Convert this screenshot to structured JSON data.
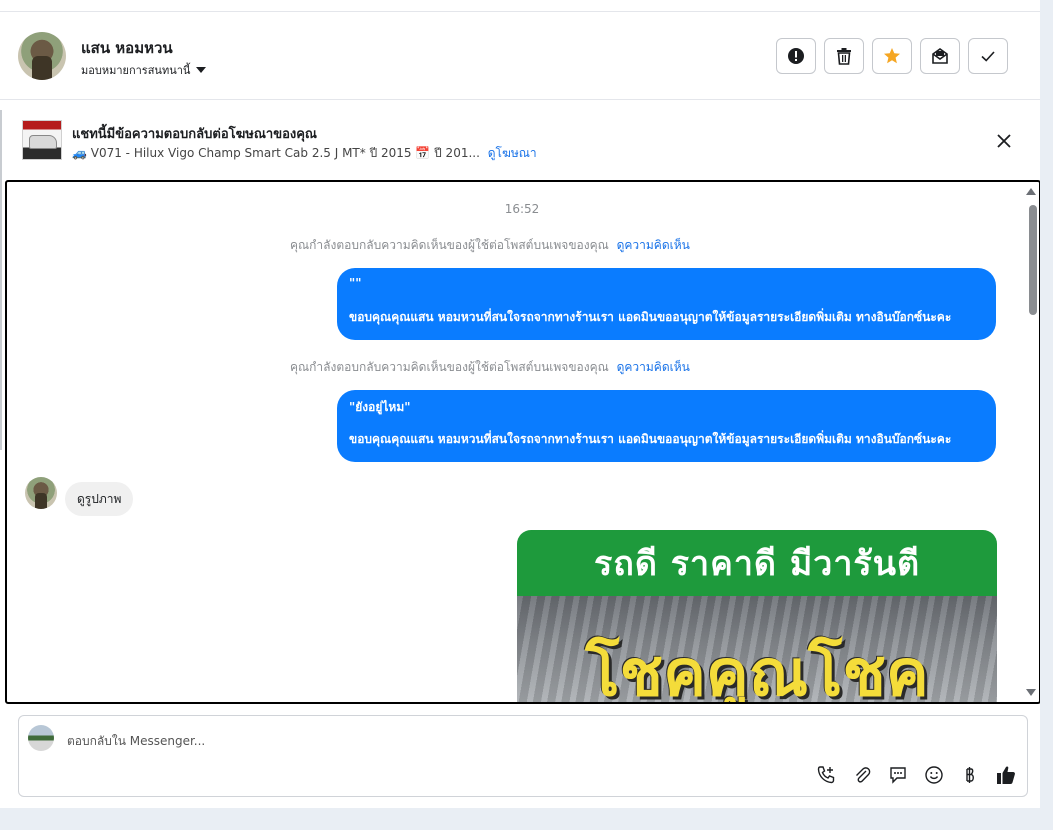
{
  "header": {
    "contact_name": "แสน หอมหวน",
    "assign_label": "มอบหมายการสนทนานี้"
  },
  "ad": {
    "title": "แชทนี้มีข้อความตอบกลับต่อโฆษณาของคุณ",
    "subtitle": "🚙 V071 - Hilux Vigo Champ Smart Cab 2.5 J MT* ปี 2015 📅 ปี 201...",
    "link": "ดูโฆษณา"
  },
  "conversation": {
    "timestamp": "16:52",
    "system_note": "คุณกำลังตอบกลับความคิดเห็นของผู้ใช้ต่อโพสต์บนเพจของคุณ",
    "system_link": "ดูความคิดเห็น",
    "messages_out": [
      {
        "quote": "\"\"",
        "body": "ขอบคุณคุณแสน หอมหวนที่สนใจรถจากทางร้านเรา แอดมินขออนุญาตให้ข้อมูลรายระเอียดพิ่มเติม ทางอินบ๊อกซ์นะคะ"
      },
      {
        "quote": "\"ยังอยู่ไหม\"",
        "body": "ขอบคุณคุณแสน หอมหวนที่สนใจรถจากทางร้านเรา แอดมินขออนุญาตให้ข้อมูลรายระเอียดพิ่มเติม ทางอินบ๊อกซ์นะคะ"
      }
    ],
    "message_in": "ดูรูปภาพ",
    "promo_banner": "รถดี  ราคาดี  มีวารันตี",
    "promo_title": "โชคคูณโชค"
  },
  "composer": {
    "placeholder": "ตอบกลับใน Messenger..."
  },
  "colors": {
    "accent": "#0a7cff",
    "star": "#f5a623",
    "link": "#1a73e8",
    "promo_green": "#1e9a3c"
  }
}
